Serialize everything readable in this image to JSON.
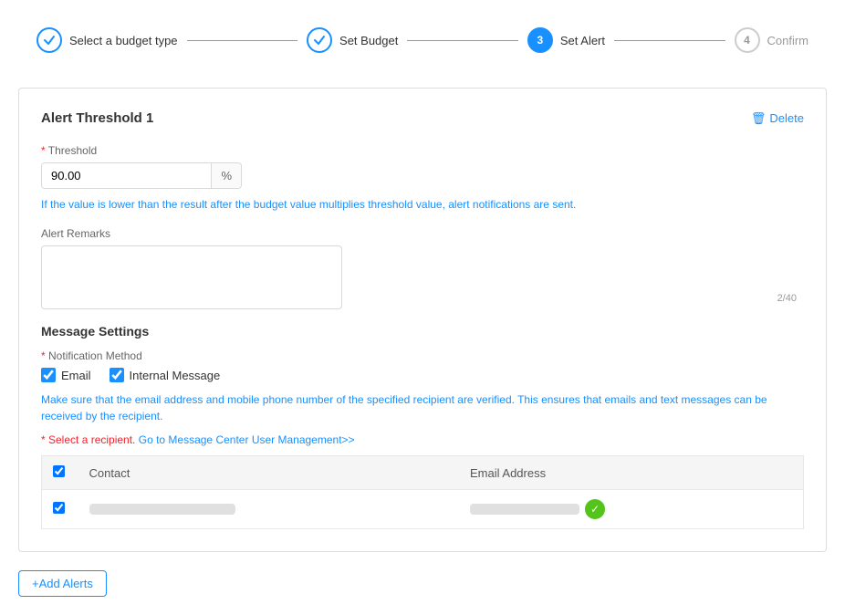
{
  "stepper": {
    "steps": [
      {
        "id": "select-budget-type",
        "label": "Select a budget type",
        "number": "✓",
        "state": "completed"
      },
      {
        "id": "set-budget",
        "label": "Set Budget",
        "number": "✓",
        "state": "completed"
      },
      {
        "id": "set-alert",
        "label": "Set Alert",
        "number": "3",
        "state": "active"
      },
      {
        "id": "confirm",
        "label": "Confirm",
        "number": "4",
        "state": "inactive"
      }
    ]
  },
  "card": {
    "title": "Alert Threshold 1",
    "delete_label": "Delete",
    "threshold_label": "Threshold",
    "threshold_value": "90.00",
    "threshold_suffix": "%",
    "hint_text": "If the value is lower than the result after the budget value multiplies threshold value, alert notifications are sent.",
    "remarks_label": "Alert Remarks",
    "remarks_placeholder": "",
    "char_count": "2/40",
    "message_settings": {
      "title": "Message Settings",
      "notification_method_label": "Notification Method",
      "email_label": "Email",
      "email_checked": true,
      "internal_message_label": "Internal Message",
      "internal_message_checked": true,
      "info_text": "Make sure that the email address and mobile phone number of the specified recipient are verified. This ensures that emails and text messages can be received by the recipient.",
      "recipient_label": "* Select a recipient.",
      "go_to_message_center": "Go to Message Center",
      "user_management": "User Management>>",
      "table": {
        "columns": [
          {
            "id": "check",
            "label": ""
          },
          {
            "id": "contact",
            "label": "Contact"
          },
          {
            "id": "email",
            "label": "Email Address"
          }
        ],
        "rows": [
          {
            "checked": true,
            "contact_placeholder": true,
            "email_placeholder": true,
            "email_verified": true
          }
        ]
      }
    }
  },
  "add_alerts_label": "+Add Alerts",
  "icons": {
    "trash": "🗑",
    "checkmark": "✓",
    "verified": "✓"
  }
}
